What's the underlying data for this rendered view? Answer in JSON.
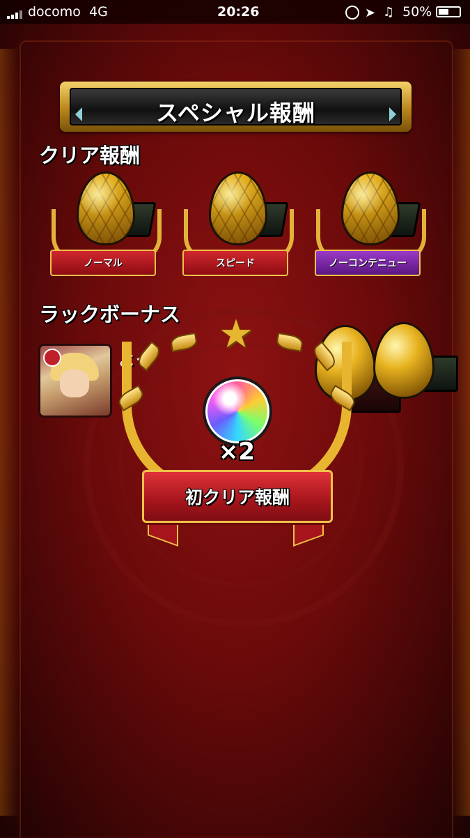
{
  "status_bar": {
    "carrier": "docomo",
    "network": "4G",
    "time": "20:26",
    "battery": "50%"
  },
  "title_banner": {
    "text": "スペシャル報酬"
  },
  "clear_rewards": {
    "heading": "クリア報酬",
    "items": [
      {
        "label": "ノーマル",
        "ribbon_color": "#c0202a"
      },
      {
        "label": "スピード",
        "ribbon_color": "#c0202a"
      },
      {
        "label": "ノーコンテニュー",
        "ribbon_color": "#7a2aa8"
      }
    ]
  },
  "luck_bonus": {
    "heading": "ラックボーナス",
    "partial_text": "よっ"
  },
  "first_clear_popup": {
    "count": "×2",
    "label": "初クリア報酬",
    "item_icon": "rainbow-orb-icon"
  },
  "colors": {
    "background": "#7a0c0c",
    "gold": "#e8b530",
    "ribbon_red": "#c0202a",
    "ribbon_purple": "#7a2aa8"
  }
}
